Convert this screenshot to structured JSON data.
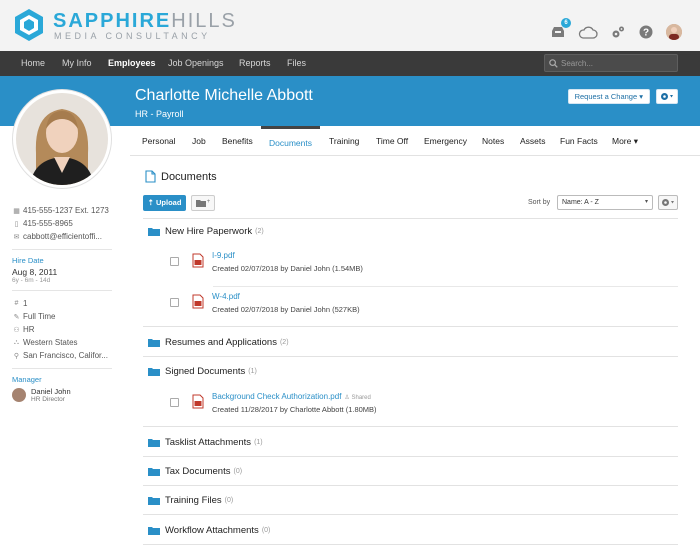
{
  "brand": {
    "name_bold": "SAPPHIRE",
    "name_light": "HILLS",
    "tagline": "MEDIA CONSULTANCY"
  },
  "top_icons": {
    "inbox_badge": "6"
  },
  "nav": {
    "items": [
      "Home",
      "My Info",
      "Employees",
      "Job Openings",
      "Reports",
      "Files"
    ],
    "active": "Employees",
    "search_placeholder": "Search..."
  },
  "employee": {
    "name": "Charlotte Michelle Abbott",
    "department": "HR - Payroll",
    "request_change": "Request a Change"
  },
  "tabs": [
    "Personal",
    "Job",
    "Benefits",
    "Documents",
    "Training",
    "Time Off",
    "Emergency",
    "Notes",
    "Assets",
    "Fun Facts",
    "More"
  ],
  "active_tab": "Documents",
  "left": {
    "phone_work": "415-555-1237 Ext. 1273",
    "phone_mobile": "415-555-8965",
    "email": "cabbott@efficientoffi...",
    "hire_date_label": "Hire Date",
    "hire_date": "Aug 8, 2011",
    "tenure": "6y - 6m - 14d",
    "employee_number": "1",
    "status": "Full Time",
    "division": "HR",
    "region": "Western States",
    "location": "San Francisco, Califor...",
    "manager_label": "Manager",
    "manager_name": "Daniel John",
    "manager_title": "HR Director"
  },
  "documents": {
    "title": "Documents",
    "upload_label": "Upload",
    "sort_label": "Sort by",
    "sort_value": "Name: A - Z",
    "folders": [
      {
        "name": "New Hire Paperwork",
        "count": "(2)",
        "files": [
          {
            "name": "I-9.pdf",
            "meta": "Created 02/07/2018 by Daniel John (1.54MB)",
            "shared": ""
          },
          {
            "name": "W-4.pdf",
            "meta": "Created 02/07/2018 by Daniel John (527KB)",
            "shared": ""
          }
        ]
      },
      {
        "name": "Resumes and Applications",
        "count": "(2)",
        "files": []
      },
      {
        "name": "Signed Documents",
        "count": "(1)",
        "files": [
          {
            "name": "Background Check Authorization.pdf",
            "meta": "Created 11/28/2017 by Charlotte Abbott (1.80MB)",
            "shared": "Shared"
          }
        ]
      },
      {
        "name": "Tasklist Attachments",
        "count": "(1)",
        "files": []
      },
      {
        "name": "Tax Documents",
        "count": "(0)",
        "files": []
      },
      {
        "name": "Training Files",
        "count": "(0)",
        "files": []
      },
      {
        "name": "Workflow Attachments",
        "count": "(0)",
        "files": []
      }
    ]
  }
}
